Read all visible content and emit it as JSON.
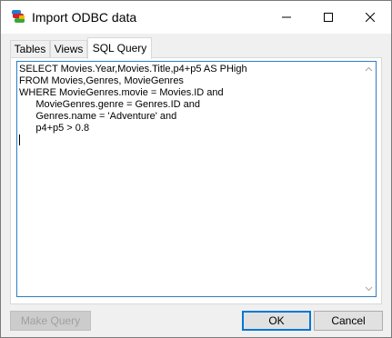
{
  "window": {
    "title": "Import ODBC data",
    "icon": "odbc-app-icon"
  },
  "caption": {
    "minimize_icon": "minimize-icon",
    "maximize_icon": "maximize-icon",
    "close_icon": "close-icon"
  },
  "tabs": [
    {
      "label": "Tables",
      "active": false
    },
    {
      "label": "Views",
      "active": false
    },
    {
      "label": "SQL Query",
      "active": true
    }
  ],
  "editor": {
    "sql": "SELECT Movies.Year,Movies.Title,p4+p5 AS PHigh\nFROM Movies,Genres, MovieGenres\nWHERE MovieGenres.movie = Movies.ID and\n      MovieGenres.genre = Genres.ID and\n      Genres.name = 'Adventure' and\n      p4+p5 > 0.8"
  },
  "buttons": {
    "make_query": "Make Query",
    "ok": "OK",
    "cancel": "Cancel"
  }
}
